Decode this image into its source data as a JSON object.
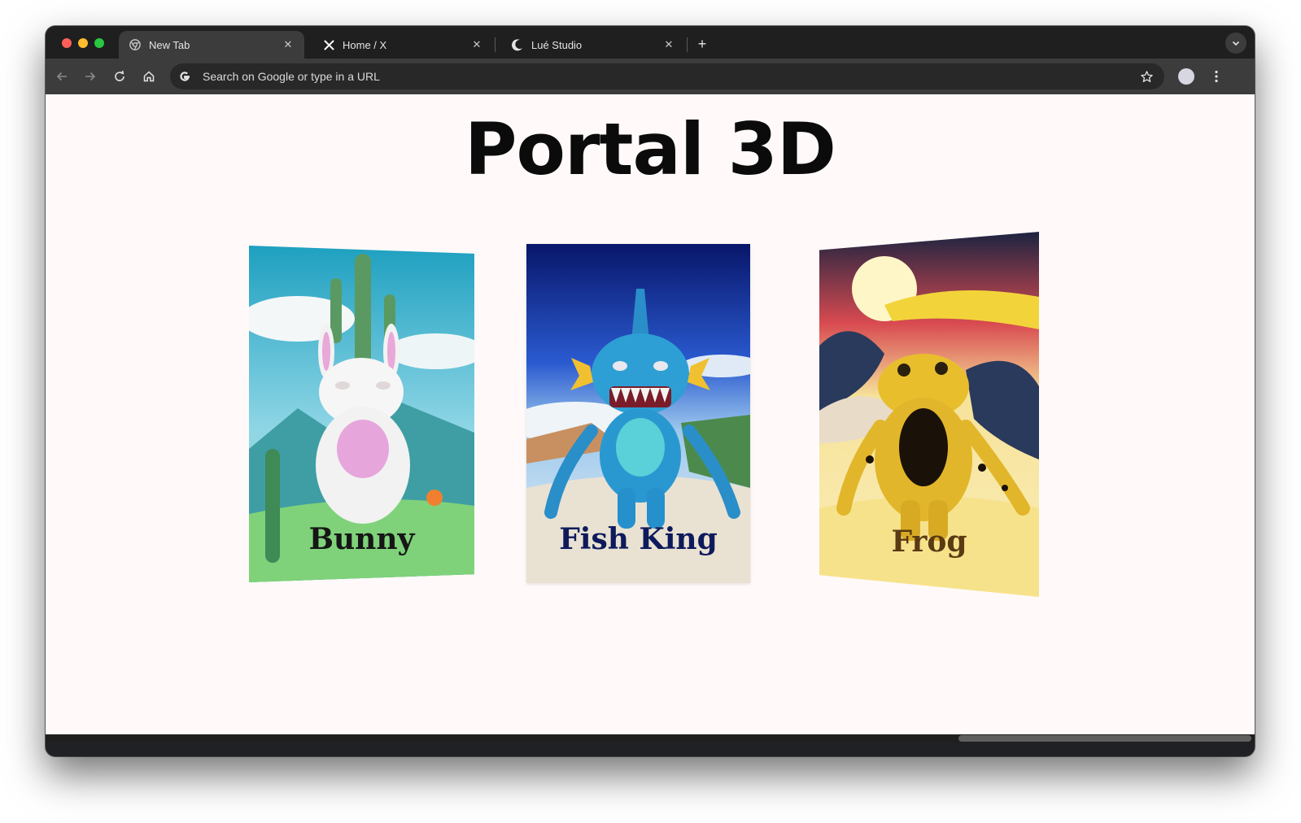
{
  "browser": {
    "tabs": [
      {
        "title": "New Tab",
        "active": true,
        "favicon": "chrome-icon"
      },
      {
        "title": "Home / X",
        "active": false,
        "favicon": "x-logo-icon"
      },
      {
        "title": "Lué Studio",
        "active": false,
        "favicon": "moon-icon"
      }
    ],
    "omnibox": {
      "placeholder": "Search on Google or type in a URL",
      "value": ""
    },
    "toolbar_icons": [
      "back-arrow-icon",
      "forward-arrow-icon",
      "reload-icon",
      "home-icon",
      "bookmark-star-icon",
      "kebab-menu-icon"
    ]
  },
  "page": {
    "title": "Portal 3D",
    "cards": [
      {
        "label": "Bunny",
        "label_color": "#161616",
        "sky_color": "#2aa8c4"
      },
      {
        "label": "Fish King",
        "label_color": "#0e1a5c",
        "sky_color": "#0a1f6e"
      },
      {
        "label": "Frog",
        "label_color": "#5a3a12",
        "sky_color": "#f2d04a"
      }
    ]
  },
  "colors": {
    "window_frame": "#202124",
    "tab_active": "#3c3c3c",
    "page_background": "#fffaf9"
  }
}
